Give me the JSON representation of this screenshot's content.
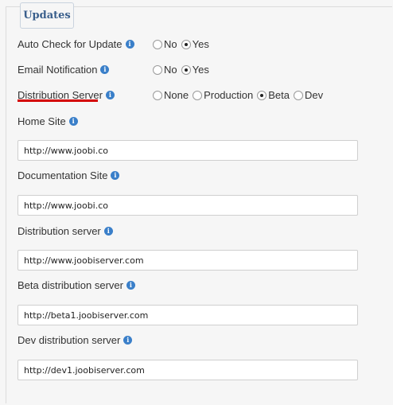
{
  "section": {
    "legend": "Updates"
  },
  "auto_check": {
    "label": "Auto Check for Update",
    "options": [
      "No",
      "Yes"
    ],
    "selected": "Yes"
  },
  "email_notification": {
    "label": "Email Notification",
    "options": [
      "No",
      "Yes"
    ],
    "selected": "Yes"
  },
  "distribution_server": {
    "label": "Distribution Server",
    "options": [
      "None",
      "Production",
      "Beta",
      "Dev"
    ],
    "selected": "Beta"
  },
  "fields": [
    {
      "label": "Home Site",
      "value": "http://www.joobi.co"
    },
    {
      "label": "Documentation Site",
      "value": "http://www.joobi.co"
    },
    {
      "label": "Distribution server",
      "value": "http://www.joobiserver.com"
    },
    {
      "label": "Beta distribution server",
      "value": "http://beta1.joobiserver.com"
    },
    {
      "label": "Dev distribution server",
      "value": "http://dev1.joobiserver.com"
    }
  ],
  "info_glyph": "i",
  "accent_color": "#3a7fc9",
  "highlight_color": "#d40000"
}
